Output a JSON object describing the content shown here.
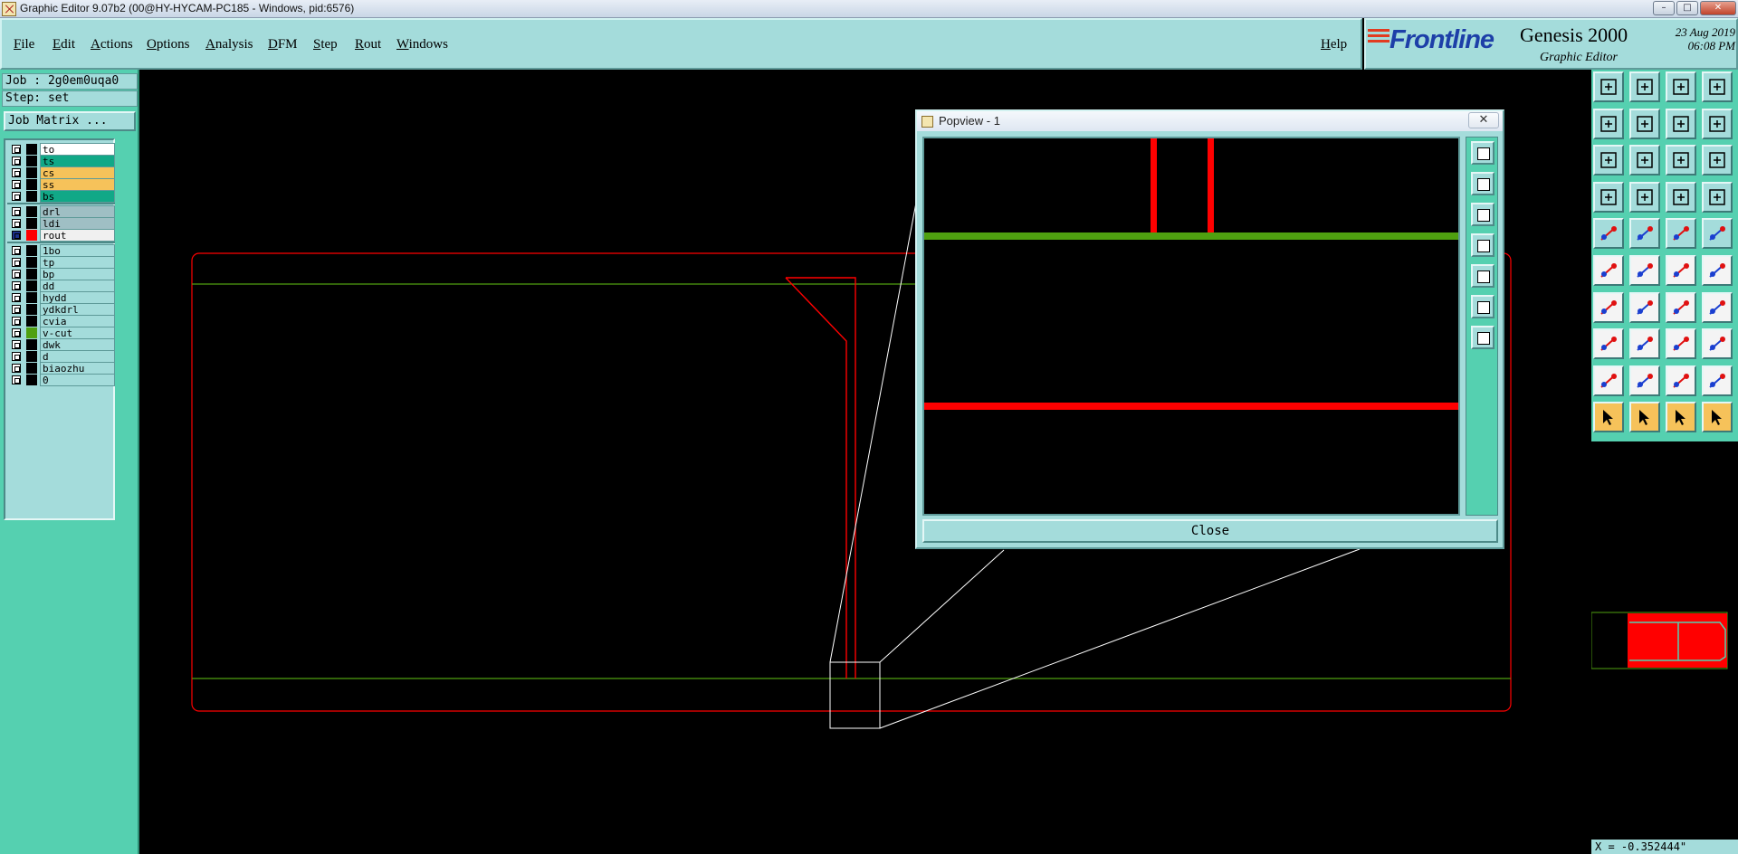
{
  "window": {
    "title": "Graphic Editor 9.07b2 (00@HY-HYCAM-PC185 - Windows, pid:6576)",
    "min_label": "–",
    "max_label": "□",
    "close_label": "✕"
  },
  "menu": {
    "file": "File",
    "edit": "Edit",
    "actions": "Actions",
    "options": "Options",
    "analysis": "Analysis",
    "dfm": "DFM",
    "step": "Step",
    "rout": "Rout",
    "windows": "Windows",
    "help": "Help"
  },
  "brand": {
    "logo": "Frontline",
    "product": "Genesis 2000",
    "subtitle": "Graphic Editor",
    "date": "23 Aug 2019",
    "time": "06:08 PM"
  },
  "left": {
    "job": "Job : 2g0em0uqa0",
    "step": "Step: set",
    "job_matrix": "Job Matrix ..."
  },
  "layers": [
    {
      "name": "to",
      "color": "#ffffff"
    },
    {
      "name": "ts",
      "color": "#11a887"
    },
    {
      "name": "cs",
      "color": "#f6c25a"
    },
    {
      "name": "ss",
      "color": "#f6c25a"
    },
    {
      "name": "bs",
      "color": "#11a887"
    },
    {
      "name": "drl",
      "color": "#9fbfc4"
    },
    {
      "name": "ldi",
      "color": "#9fbfc4"
    },
    {
      "name": "rout",
      "color": "#f0f0f0"
    },
    {
      "name": "1bo",
      "color": "#a4dcdb"
    },
    {
      "name": "tp",
      "color": "#a4dcdb"
    },
    {
      "name": "bp",
      "color": "#a4dcdb"
    },
    {
      "name": "dd",
      "color": "#a4dcdb"
    },
    {
      "name": "hydd",
      "color": "#a4dcdb"
    },
    {
      "name": "ydkdrl",
      "color": "#a4dcdb"
    },
    {
      "name": "cvia",
      "color": "#a4dcdb"
    },
    {
      "name": "v-cut",
      "color": "#a4dcdb"
    },
    {
      "name": "dwk",
      "color": "#a4dcdb"
    },
    {
      "name": "d",
      "color": "#a4dcdb"
    },
    {
      "name": "biaozhu",
      "color": "#a4dcdb"
    },
    {
      "name": "0",
      "color": "#a4dcdb"
    }
  ],
  "popview": {
    "title": "Popview - 1",
    "close_x": "✕",
    "close_button": "Close"
  },
  "status": {
    "coordinate": "X = -0.352444\""
  },
  "colors": {
    "rout": "#ff0000",
    "v_cut": "#4fa010",
    "panel": "#a4dcdb",
    "accent": "#55d0b0"
  }
}
